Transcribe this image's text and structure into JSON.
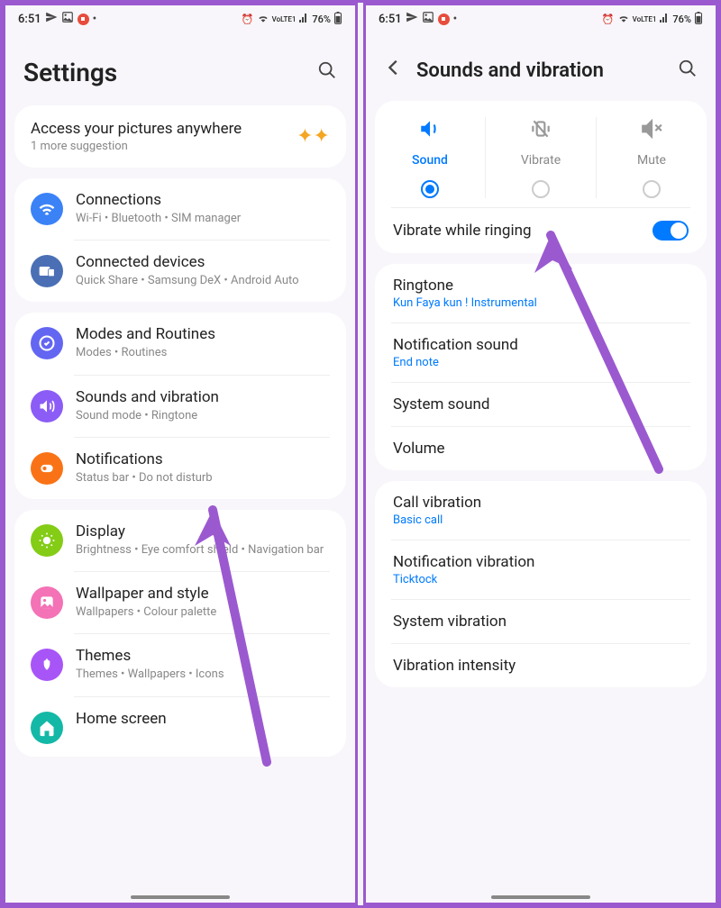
{
  "statusBar": {
    "time": "6:51",
    "battery": "76%",
    "network": "VoLTE1"
  },
  "screen1": {
    "title": "Settings",
    "suggestion": {
      "title": "Access your pictures anywhere",
      "sub": "1 more suggestion"
    },
    "groups": [
      [
        {
          "title": "Connections",
          "sub": "Wi-Fi  •  Bluetooth  •  SIM manager",
          "color": "icon-blue",
          "icon": "wifi"
        },
        {
          "title": "Connected devices",
          "sub": "Quick Share  •  Samsung DeX  •  Android Auto",
          "color": "icon-navy",
          "icon": "devices"
        }
      ],
      [
        {
          "title": "Modes and Routines",
          "sub": "Modes  •  Routines",
          "color": "icon-indigo",
          "icon": "routines"
        },
        {
          "title": "Sounds and vibration",
          "sub": "Sound mode  •  Ringtone",
          "color": "icon-purple",
          "icon": "sound"
        },
        {
          "title": "Notifications",
          "sub": "Status bar  •  Do not disturb",
          "color": "icon-orange",
          "icon": "notif"
        }
      ],
      [
        {
          "title": "Display",
          "sub": "Brightness  •  Eye comfort shield  •  Navigation bar",
          "color": "icon-green",
          "icon": "display"
        },
        {
          "title": "Wallpaper and style",
          "sub": "Wallpapers  •  Colour palette",
          "color": "icon-pink",
          "icon": "wallpaper"
        },
        {
          "title": "Themes",
          "sub": "Themes  •  Wallpapers  •  Icons",
          "color": "icon-violet",
          "icon": "themes"
        },
        {
          "title": "Home screen",
          "sub": "",
          "color": "icon-teal",
          "icon": "home"
        }
      ]
    ]
  },
  "screen2": {
    "title": "Sounds and vibration",
    "modes": [
      {
        "label": "Sound",
        "selected": true
      },
      {
        "label": "Vibrate",
        "selected": false
      },
      {
        "label": "Mute",
        "selected": false
      }
    ],
    "vibrateWhileRinging": {
      "label": "Vibrate while ringing",
      "on": true
    },
    "group1": [
      {
        "title": "Ringtone",
        "sub": "Kun Faya kun ! Instrumental"
      },
      {
        "title": "Notification sound",
        "sub": "End note"
      },
      {
        "title": "System sound",
        "sub": ""
      },
      {
        "title": "Volume",
        "sub": ""
      }
    ],
    "group2": [
      {
        "title": "Call vibration",
        "sub": "Basic call"
      },
      {
        "title": "Notification vibration",
        "sub": "Ticktock"
      },
      {
        "title": "System vibration",
        "sub": ""
      },
      {
        "title": "Vibration intensity",
        "sub": ""
      }
    ]
  }
}
